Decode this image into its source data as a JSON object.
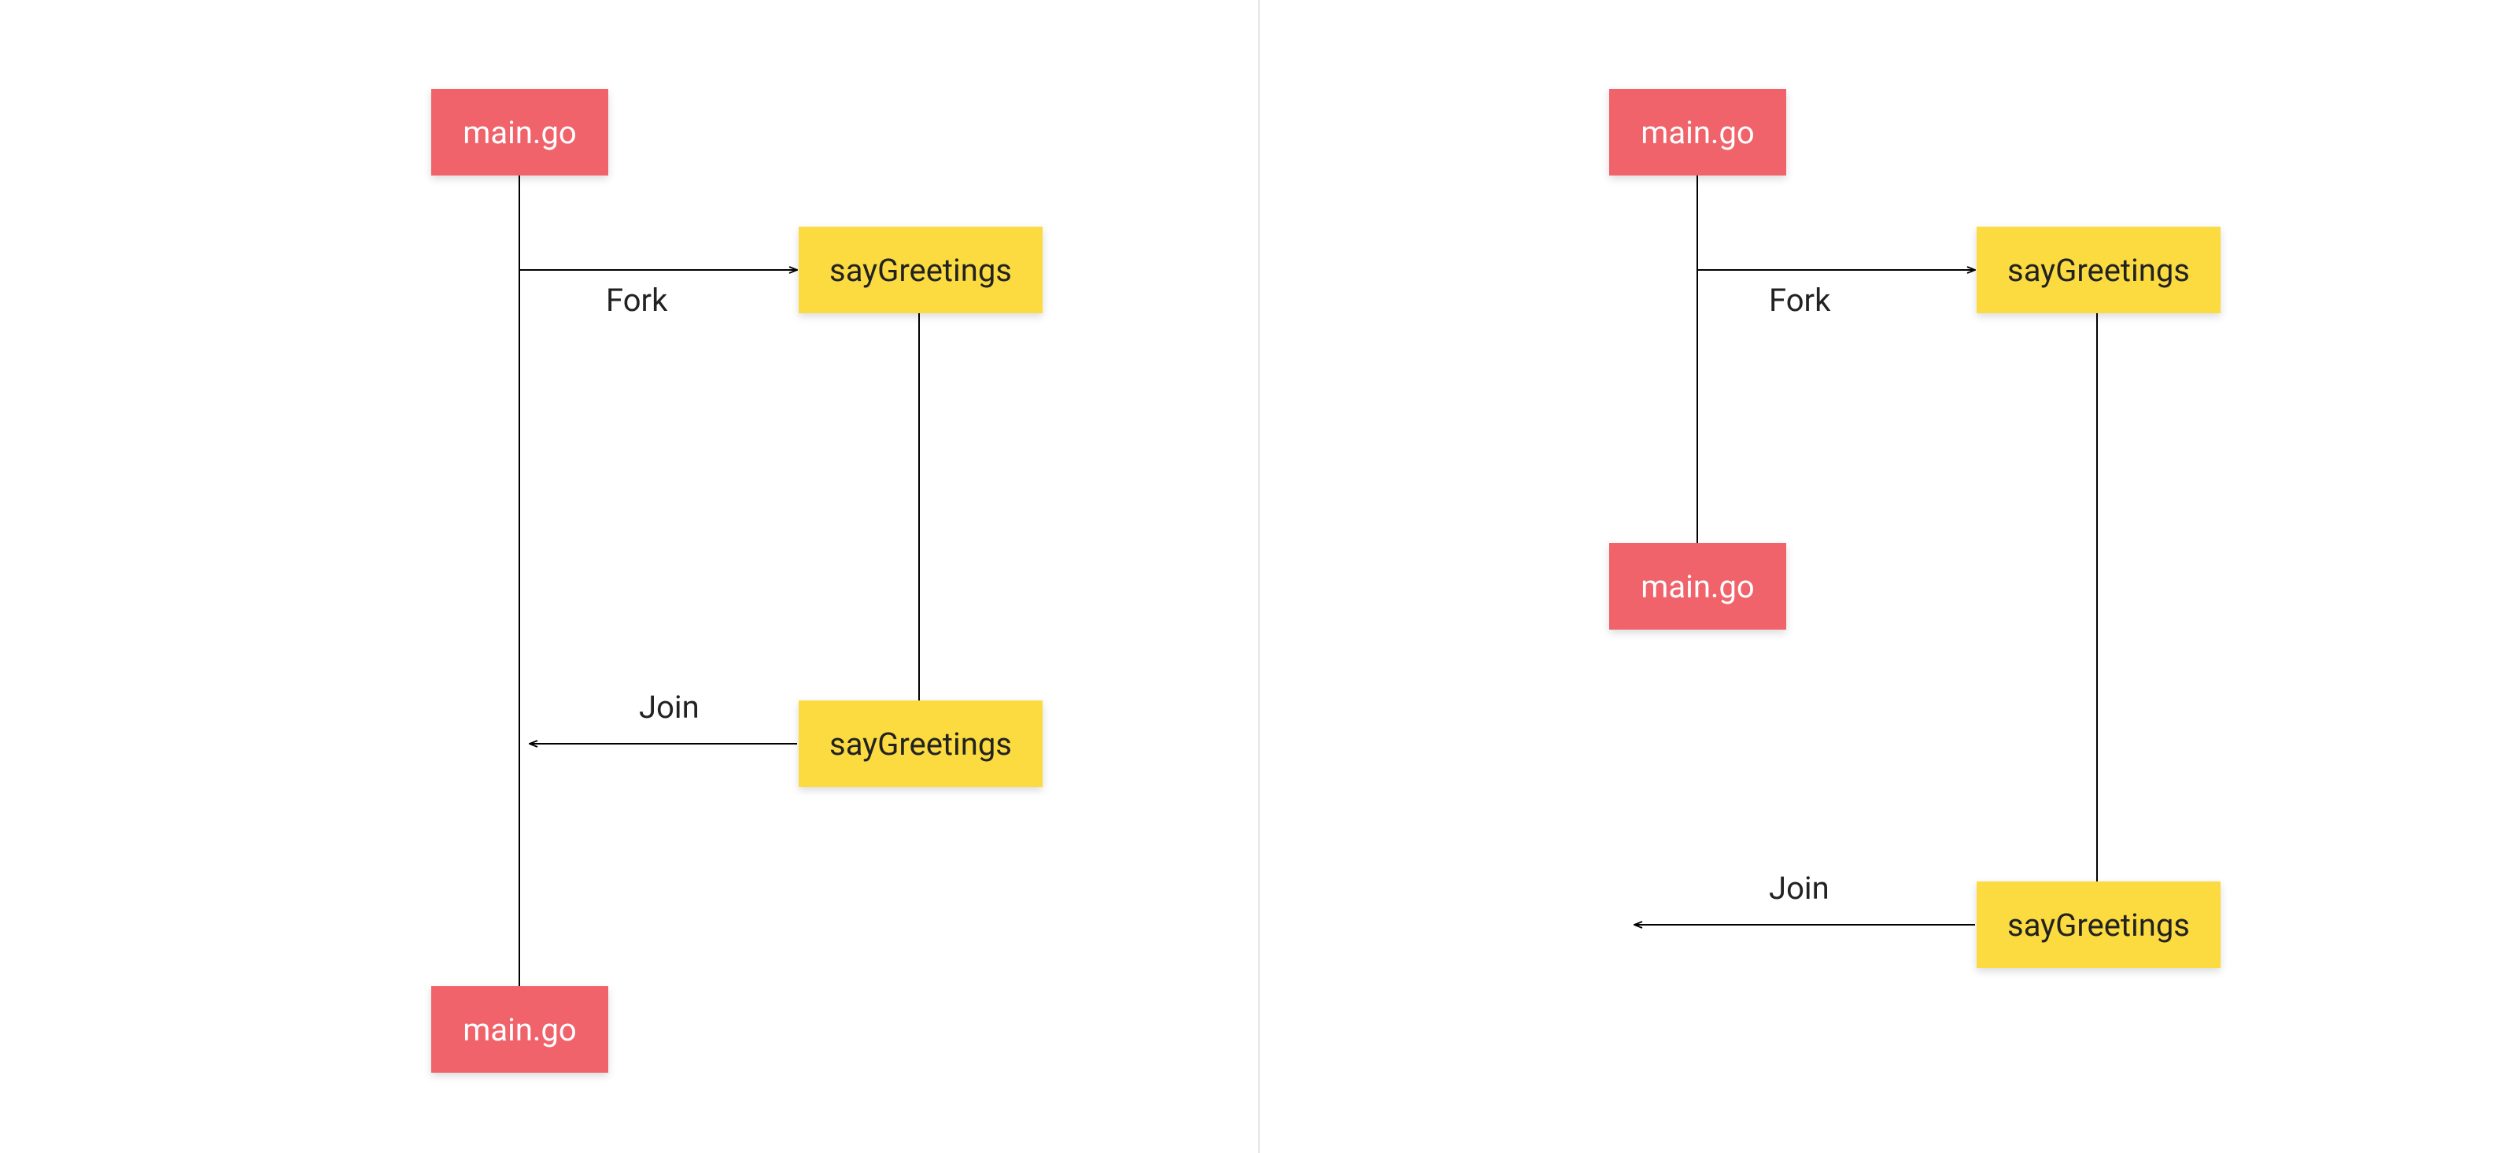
{
  "colors": {
    "redBox": "#f0636b",
    "yellowBox": "#fbdb40",
    "divider": "#e5e5e5",
    "arrow": "#000000"
  },
  "left": {
    "mainTop": "main.go",
    "sayGreetingsTop": "sayGreetings",
    "sayGreetingsBottom": "sayGreetings",
    "mainBottom": "main.go",
    "forkLabel": "Fork",
    "joinLabel": "Join"
  },
  "right": {
    "mainTop": "main.go",
    "sayGreetingsTop": "sayGreetings",
    "mainMiddle": "main.go",
    "sayGreetingsBottom": "sayGreetings",
    "forkLabel": "Fork",
    "joinLabel": "Join"
  }
}
